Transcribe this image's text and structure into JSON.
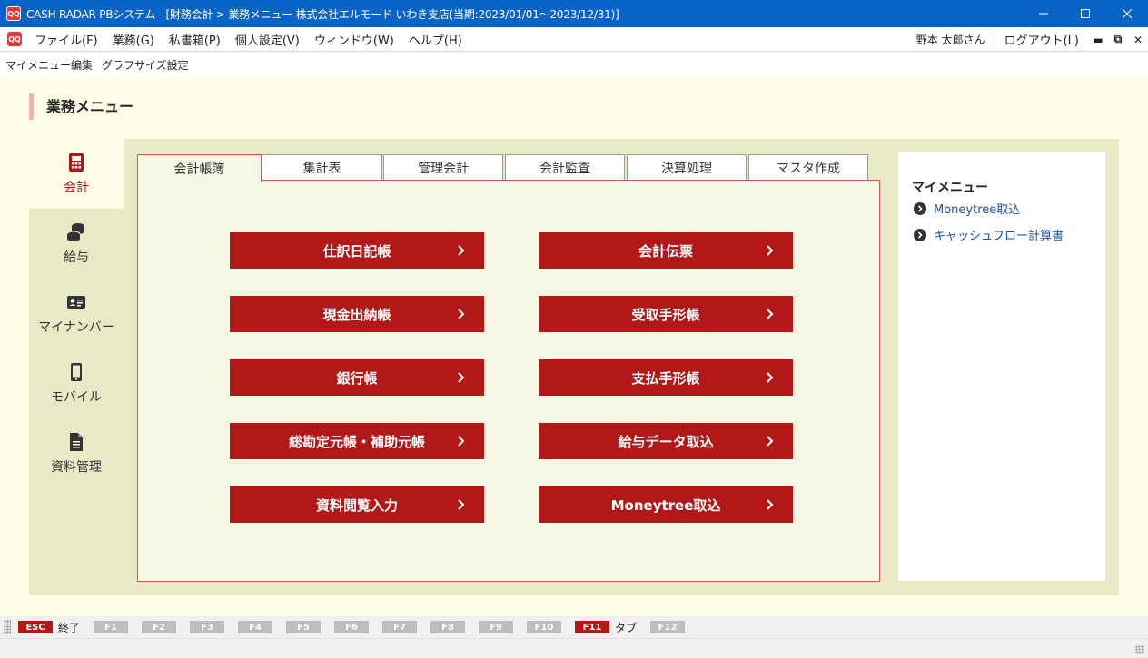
{
  "window": {
    "app_logo": "QQ",
    "title": "CASH RADAR PBシステム - [財務会計 > 業務メニュー 株式会社エルモード いわき支店(当期:2023/01/01～2023/12/31)]"
  },
  "menubar": {
    "items": [
      "ファイル(F)",
      "業務(G)",
      "私書箱(P)",
      "個人設定(V)",
      "ウィンドウ(W)",
      "ヘルプ(H)"
    ],
    "user": "野本 太郎さん",
    "logout": "ログアウト(L)"
  },
  "toolbar": {
    "items": [
      "マイメニュー編集",
      "グラフサイズ設定"
    ]
  },
  "page": {
    "title": "業務メニュー"
  },
  "side_tabs": [
    {
      "label": "会計",
      "icon": "calculator-icon",
      "active": true
    },
    {
      "label": "給与",
      "icon": "coins-icon",
      "active": false
    },
    {
      "label": "マイナンバー",
      "icon": "id-card-icon",
      "active": false
    },
    {
      "label": "モバイル",
      "icon": "smartphone-icon",
      "active": false
    },
    {
      "label": "資料管理",
      "icon": "document-icon",
      "active": false
    }
  ],
  "tabs": [
    {
      "label": "会計帳簿",
      "active": true
    },
    {
      "label": "集計表"
    },
    {
      "label": "管理会計"
    },
    {
      "label": "会計監査"
    },
    {
      "label": "決算処理"
    },
    {
      "label": "マスタ作成"
    }
  ],
  "buttons": [
    "仕訳日記帳",
    "会計伝票",
    "現金出納帳",
    "受取手形帳",
    "銀行帳",
    "支払手形帳",
    "総勘定元帳・補助元帳",
    "給与データ取込",
    "資料閲覧入力",
    "Moneytree取込"
  ],
  "mymenu": {
    "title": "マイメニュー",
    "items": [
      "Moneytree取込",
      "キャッシュフロー計算書"
    ]
  },
  "fkeys": [
    {
      "key": "ESC",
      "label": "終了",
      "active": true
    },
    {
      "key": "F1"
    },
    {
      "key": "F2"
    },
    {
      "key": "F3"
    },
    {
      "key": "F4"
    },
    {
      "key": "F5"
    },
    {
      "key": "F6"
    },
    {
      "key": "F7"
    },
    {
      "key": "F8"
    },
    {
      "key": "F9"
    },
    {
      "key": "F10"
    },
    {
      "key": "F11",
      "label": "タブ",
      "active": true
    },
    {
      "key": "F12"
    }
  ],
  "colors": {
    "titlebar": "#0a64c8",
    "accent": "#b31818",
    "panel": "#e9e9c8",
    "background": "#fefee6"
  }
}
